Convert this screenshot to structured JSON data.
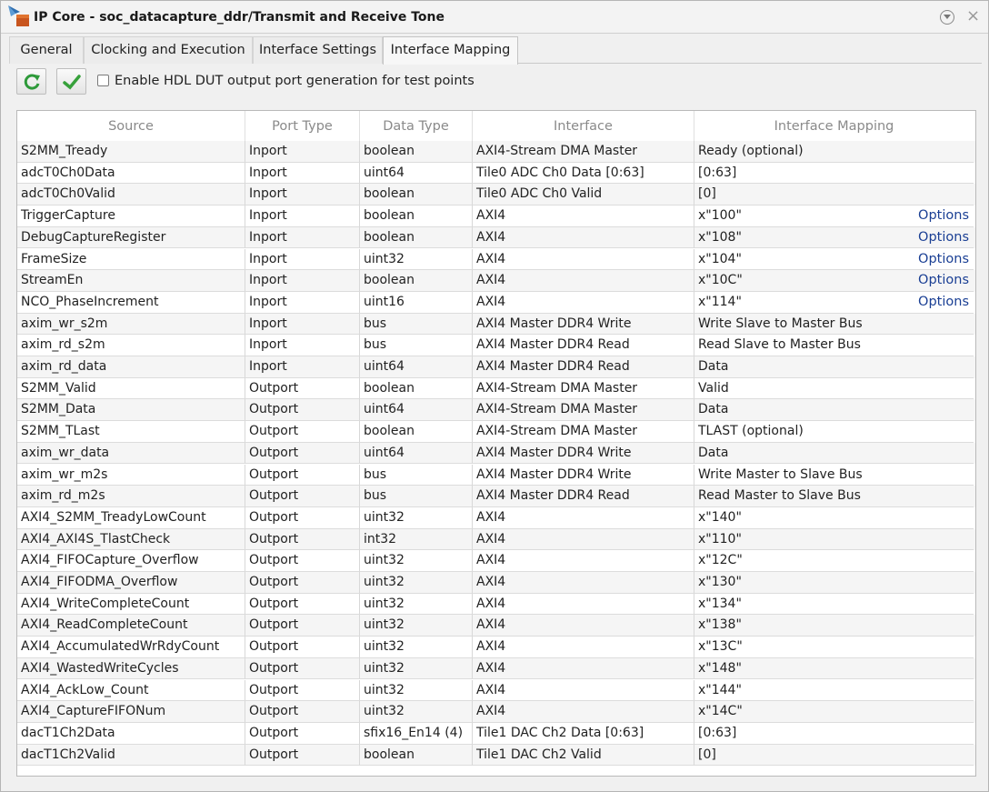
{
  "window": {
    "title": "IP Core - soc_datacapture_ddr/Transmit and Receive Tone",
    "icons": [
      "simulink-ip-core-icon",
      "collapse-menu-icon",
      "close-icon"
    ]
  },
  "tabs": [
    {
      "label": "General",
      "active": false
    },
    {
      "label": "Clocking and Execution",
      "active": false
    },
    {
      "label": "Interface Settings",
      "active": false
    },
    {
      "label": "Interface Mapping",
      "active": true
    }
  ],
  "toolbar": {
    "refresh_icon": "refresh-icon",
    "apply_icon": "checkmark-icon",
    "checkbox_label": "Enable HDL DUT output port generation for test points",
    "checkbox_checked": false
  },
  "table": {
    "columns": [
      "Source",
      "Port Type",
      "Data Type",
      "Interface",
      "Interface Mapping"
    ],
    "options_label": "Options",
    "options_color": "#1a3f94",
    "rows": [
      {
        "source": "S2MM_Tready",
        "port_type": "Inport",
        "data_type": "boolean",
        "interface": "AXI4-Stream DMA Master",
        "mapping": "Ready (optional)",
        "options": ""
      },
      {
        "source": "adcT0Ch0Data",
        "port_type": "Inport",
        "data_type": "uint64",
        "interface": "Tile0 ADC Ch0 Data [0:63]",
        "mapping": "[0:63]",
        "options": ""
      },
      {
        "source": "adcT0Ch0Valid",
        "port_type": "Inport",
        "data_type": "boolean",
        "interface": "Tile0 ADC Ch0 Valid",
        "mapping": "[0]",
        "options": ""
      },
      {
        "source": "TriggerCapture",
        "port_type": "Inport",
        "data_type": "boolean",
        "interface": "AXI4",
        "mapping": "x\"100\"",
        "options": "Options"
      },
      {
        "source": "DebugCaptureRegister",
        "port_type": "Inport",
        "data_type": "boolean",
        "interface": "AXI4",
        "mapping": "x\"108\"",
        "options": "Options"
      },
      {
        "source": "FrameSize",
        "port_type": "Inport",
        "data_type": "uint32",
        "interface": "AXI4",
        "mapping": "x\"104\"",
        "options": "Options"
      },
      {
        "source": "StreamEn",
        "port_type": "Inport",
        "data_type": "boolean",
        "interface": "AXI4",
        "mapping": "x\"10C\"",
        "options": "Options"
      },
      {
        "source": "NCO_PhaseIncrement",
        "port_type": "Inport",
        "data_type": "uint16",
        "interface": "AXI4",
        "mapping": "x\"114\"",
        "options": "Options"
      },
      {
        "source": "axim_wr_s2m",
        "port_type": "Inport",
        "data_type": "bus",
        "interface": "AXI4 Master DDR4 Write",
        "mapping": "Write Slave to Master Bus",
        "options": ""
      },
      {
        "source": "axim_rd_s2m",
        "port_type": "Inport",
        "data_type": "bus",
        "interface": "AXI4 Master DDR4 Read",
        "mapping": "Read Slave to Master Bus",
        "options": ""
      },
      {
        "source": "axim_rd_data",
        "port_type": "Inport",
        "data_type": "uint64",
        "interface": "AXI4 Master DDR4 Read",
        "mapping": "Data",
        "options": ""
      },
      {
        "source": "S2MM_Valid",
        "port_type": "Outport",
        "data_type": "boolean",
        "interface": "AXI4-Stream DMA Master",
        "mapping": "Valid",
        "options": ""
      },
      {
        "source": "S2MM_Data",
        "port_type": "Outport",
        "data_type": "uint64",
        "interface": "AXI4-Stream DMA Master",
        "mapping": "Data",
        "options": ""
      },
      {
        "source": "S2MM_TLast",
        "port_type": "Outport",
        "data_type": "boolean",
        "interface": "AXI4-Stream DMA Master",
        "mapping": "TLAST (optional)",
        "options": ""
      },
      {
        "source": "axim_wr_data",
        "port_type": "Outport",
        "data_type": "uint64",
        "interface": "AXI4 Master DDR4 Write",
        "mapping": "Data",
        "options": ""
      },
      {
        "source": "axim_wr_m2s",
        "port_type": "Outport",
        "data_type": "bus",
        "interface": "AXI4 Master DDR4 Write",
        "mapping": "Write Master to Slave Bus",
        "options": ""
      },
      {
        "source": "axim_rd_m2s",
        "port_type": "Outport",
        "data_type": "bus",
        "interface": "AXI4 Master DDR4 Read",
        "mapping": "Read Master to Slave Bus",
        "options": ""
      },
      {
        "source": "AXI4_S2MM_TreadyLowCount",
        "port_type": "Outport",
        "data_type": "uint32",
        "interface": "AXI4",
        "mapping": "x\"140\"",
        "options": ""
      },
      {
        "source": "AXI4_AXI4S_TlastCheck",
        "port_type": "Outport",
        "data_type": "int32",
        "interface": "AXI4",
        "mapping": "x\"110\"",
        "options": ""
      },
      {
        "source": "AXI4_FIFOCapture_Overflow",
        "port_type": "Outport",
        "data_type": "uint32",
        "interface": "AXI4",
        "mapping": "x\"12C\"",
        "options": ""
      },
      {
        "source": "AXI4_FIFODMA_Overflow",
        "port_type": "Outport",
        "data_type": "uint32",
        "interface": "AXI4",
        "mapping": "x\"130\"",
        "options": ""
      },
      {
        "source": "AXI4_WriteCompleteCount",
        "port_type": "Outport",
        "data_type": "uint32",
        "interface": "AXI4",
        "mapping": "x\"134\"",
        "options": ""
      },
      {
        "source": "AXI4_ReadCompleteCount",
        "port_type": "Outport",
        "data_type": "uint32",
        "interface": "AXI4",
        "mapping": "x\"138\"",
        "options": ""
      },
      {
        "source": "AXI4_AccumulatedWrRdyCount",
        "port_type": "Outport",
        "data_type": "uint32",
        "interface": "AXI4",
        "mapping": "x\"13C\"",
        "options": ""
      },
      {
        "source": "AXI4_WastedWriteCycles",
        "port_type": "Outport",
        "data_type": "uint32",
        "interface": "AXI4",
        "mapping": "x\"148\"",
        "options": ""
      },
      {
        "source": "AXI4_AckLow_Count",
        "port_type": "Outport",
        "data_type": "uint32",
        "interface": "AXI4",
        "mapping": "x\"144\"",
        "options": ""
      },
      {
        "source": "AXI4_CaptureFIFONum",
        "port_type": "Outport",
        "data_type": "uint32",
        "interface": "AXI4",
        "mapping": "x\"14C\"",
        "options": ""
      },
      {
        "source": "dacT1Ch2Data",
        "port_type": "Outport",
        "data_type": "sfix16_En14 (4)",
        "interface": "Tile1 DAC Ch2 Data [0:63]",
        "mapping": "[0:63]",
        "options": ""
      },
      {
        "source": "dacT1Ch2Valid",
        "port_type": "Outport",
        "data_type": "boolean",
        "interface": "Tile1 DAC Ch2 Valid",
        "mapping": "[0]",
        "options": ""
      }
    ]
  }
}
